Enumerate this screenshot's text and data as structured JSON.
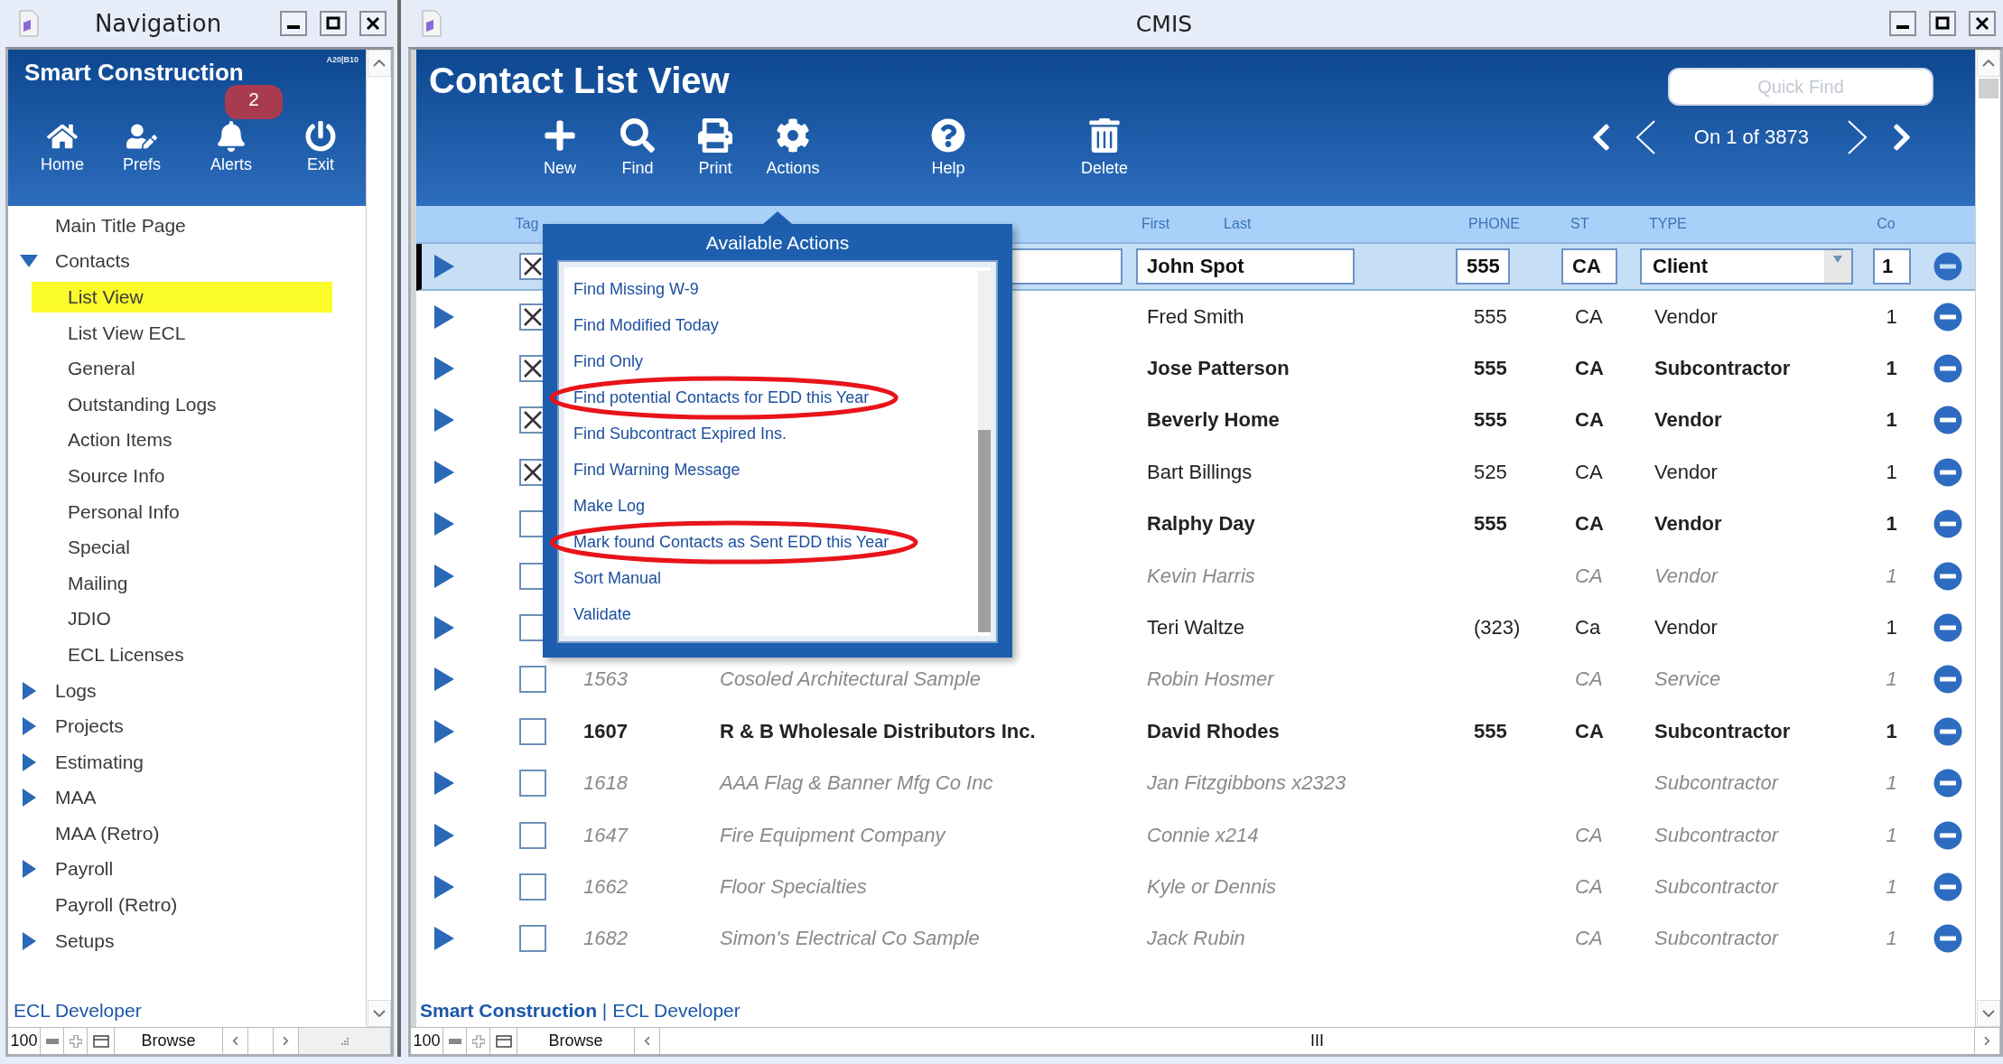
{
  "nav": {
    "window_title": "Navigation",
    "app_name": "Smart Construction",
    "version": "A20|B10",
    "toolbar": [
      {
        "label": "Home",
        "kind": "home"
      },
      {
        "label": "Prefs",
        "kind": "prefs"
      },
      {
        "label": "Alerts",
        "kind": "alerts",
        "badge": "2"
      },
      {
        "label": "Exit",
        "kind": "exit"
      }
    ],
    "tree": [
      {
        "label": "Main Title Page",
        "selected": false
      },
      {
        "label": "Contacts",
        "selected": false,
        "expanded": true,
        "children": [
          {
            "label": "List View",
            "selected": true
          },
          {
            "label": "List View ECL",
            "selected": false
          },
          {
            "label": "General",
            "selected": false
          },
          {
            "label": "Outstanding Logs",
            "selected": false
          },
          {
            "label": "Action Items",
            "selected": false
          },
          {
            "label": "Source Info",
            "selected": false
          },
          {
            "label": "Personal Info",
            "selected": false
          },
          {
            "label": "Special",
            "selected": false
          },
          {
            "label": "Mailing",
            "selected": false
          },
          {
            "label": "JDIO",
            "selected": false
          },
          {
            "label": "ECL Licenses",
            "selected": false
          }
        ]
      },
      {
        "label": "Logs",
        "selected": false,
        "expanded": false
      },
      {
        "label": "Projects",
        "selected": false,
        "expanded": false
      },
      {
        "label": "Estimating",
        "selected": false,
        "expanded": false
      },
      {
        "label": "MAA",
        "selected": false,
        "expanded": false
      },
      {
        "label": "MAA (Retro)",
        "selected": false
      },
      {
        "label": "Payroll",
        "selected": false,
        "expanded": false
      },
      {
        "label": "Payroll (Retro)",
        "selected": false
      },
      {
        "label": "Setups",
        "selected": false,
        "expanded": false
      }
    ],
    "footer": "ECL Developer",
    "status_bar": {
      "zoom": "100",
      "mode": "Browse"
    }
  },
  "main": {
    "window_title": "CMIS",
    "title": "Contact List View",
    "search": {
      "placeholder": "Quick Find"
    },
    "toolbar": [
      {
        "label": "New",
        "kind": "new"
      },
      {
        "label": "Find",
        "kind": "find"
      },
      {
        "label": "Print",
        "kind": "print"
      },
      {
        "label": "Actions",
        "kind": "actions"
      },
      {
        "label": "Help",
        "kind": "help"
      },
      {
        "label": "Delete",
        "kind": "delete"
      }
    ],
    "record_counter": "On 1 of 3873",
    "table": {
      "columns": [
        "Tag",
        "First",
        "Last",
        "PHONE",
        "ST",
        "TYPE",
        "Co"
      ],
      "rows": [
        {
          "selected": true,
          "tagged": true,
          "kind": "active",
          "name": "John Spot",
          "phone": "555",
          "st": "CA",
          "type": "Client",
          "co": "1"
        },
        {
          "selected": false,
          "tagged": true,
          "kind": "plain",
          "name": "Fred Smith",
          "phone": "555",
          "st": "CA",
          "type": "Vendor",
          "co": "1"
        },
        {
          "selected": false,
          "tagged": true,
          "kind": "active",
          "name": "Jose Patterson",
          "phone": "555",
          "st": "CA",
          "type": "Subcontractor",
          "co": "1"
        },
        {
          "selected": false,
          "tagged": true,
          "kind": "active",
          "name": "Beverly Home",
          "phone": "555",
          "st": "CA",
          "type": "Vendor",
          "co": "1"
        },
        {
          "selected": false,
          "tagged": true,
          "kind": "plain",
          "name": "Bart Billings",
          "phone": "525",
          "st": "CA",
          "type": "Vendor",
          "co": "1"
        },
        {
          "selected": false,
          "tagged": false,
          "kind": "active",
          "name": "Ralphy Day",
          "phone": "555",
          "st": "CA",
          "type": "Vendor",
          "co": "1"
        },
        {
          "selected": false,
          "tagged": false,
          "kind": "inactive",
          "name": "Kevin Harris",
          "st": "CA",
          "type": "Vendor",
          "co": "1"
        },
        {
          "selected": false,
          "tagged": false,
          "kind": "plain",
          "name": "Teri Waltze",
          "phone": "(323)",
          "st": "Ca",
          "type": "Vendor",
          "co": "1"
        },
        {
          "selected": false,
          "tagged": false,
          "kind": "inactive",
          "code": "1563",
          "company": "Cosoled Architectural Sample",
          "name": "Robin Hosmer",
          "st": "CA",
          "type": "Service",
          "co": "1"
        },
        {
          "selected": false,
          "tagged": false,
          "kind": "active",
          "code": "1607",
          "company": "R & B Wholesale Distributors Inc.",
          "name": "David Rhodes",
          "phone": "555",
          "st": "CA",
          "type": "Subcontractor",
          "co": "1"
        },
        {
          "selected": false,
          "tagged": false,
          "kind": "inactive",
          "code": "1618",
          "company": "AAA Flag & Banner Mfg Co Inc",
          "name": "Jan Fitzgibbons x2323",
          "type": "Subcontractor",
          "co": "1"
        },
        {
          "selected": false,
          "tagged": false,
          "kind": "inactive",
          "code": "1647",
          "company": "Fire Equipment Company",
          "name": "Connie x214",
          "st": "CA",
          "type": "Subcontractor",
          "co": "1"
        },
        {
          "selected": false,
          "tagged": false,
          "kind": "inactive",
          "code": "1662",
          "company": "Floor Specialties",
          "name": "Kyle or Dennis",
          "st": "CA",
          "type": "Subcontractor",
          "co": "1"
        },
        {
          "selected": false,
          "tagged": false,
          "kind": "inactive",
          "code": "1682",
          "company": "Simon's Electrical Co Sample",
          "name": "Jack Rubin",
          "st": "CA",
          "type": "Subcontractor",
          "co": "1"
        }
      ]
    },
    "actions_popup": {
      "title": "Available Actions",
      "items": [
        {
          "label": "Find Missing W-9",
          "circled": false
        },
        {
          "label": "Find Modified Today",
          "circled": false
        },
        {
          "label": "Find Only",
          "circled": false
        },
        {
          "label": "Find potential Contacts for EDD this Year",
          "circled": true
        },
        {
          "label": "Find Subcontract Expired Ins.",
          "circled": false
        },
        {
          "label": "Find Warning Message",
          "circled": false
        },
        {
          "label": "Make Log",
          "circled": false
        },
        {
          "label": "Mark found Contacts as Sent EDD this Year",
          "circled": true
        },
        {
          "label": "Sort Manual",
          "circled": false
        },
        {
          "label": "Validate",
          "circled": false
        }
      ]
    },
    "footer": "**Smart Construction** | ECL Developer",
    "status_bar": {
      "zoom": "100",
      "mode": "Browse",
      "scroll_thumb": "III"
    }
  }
}
